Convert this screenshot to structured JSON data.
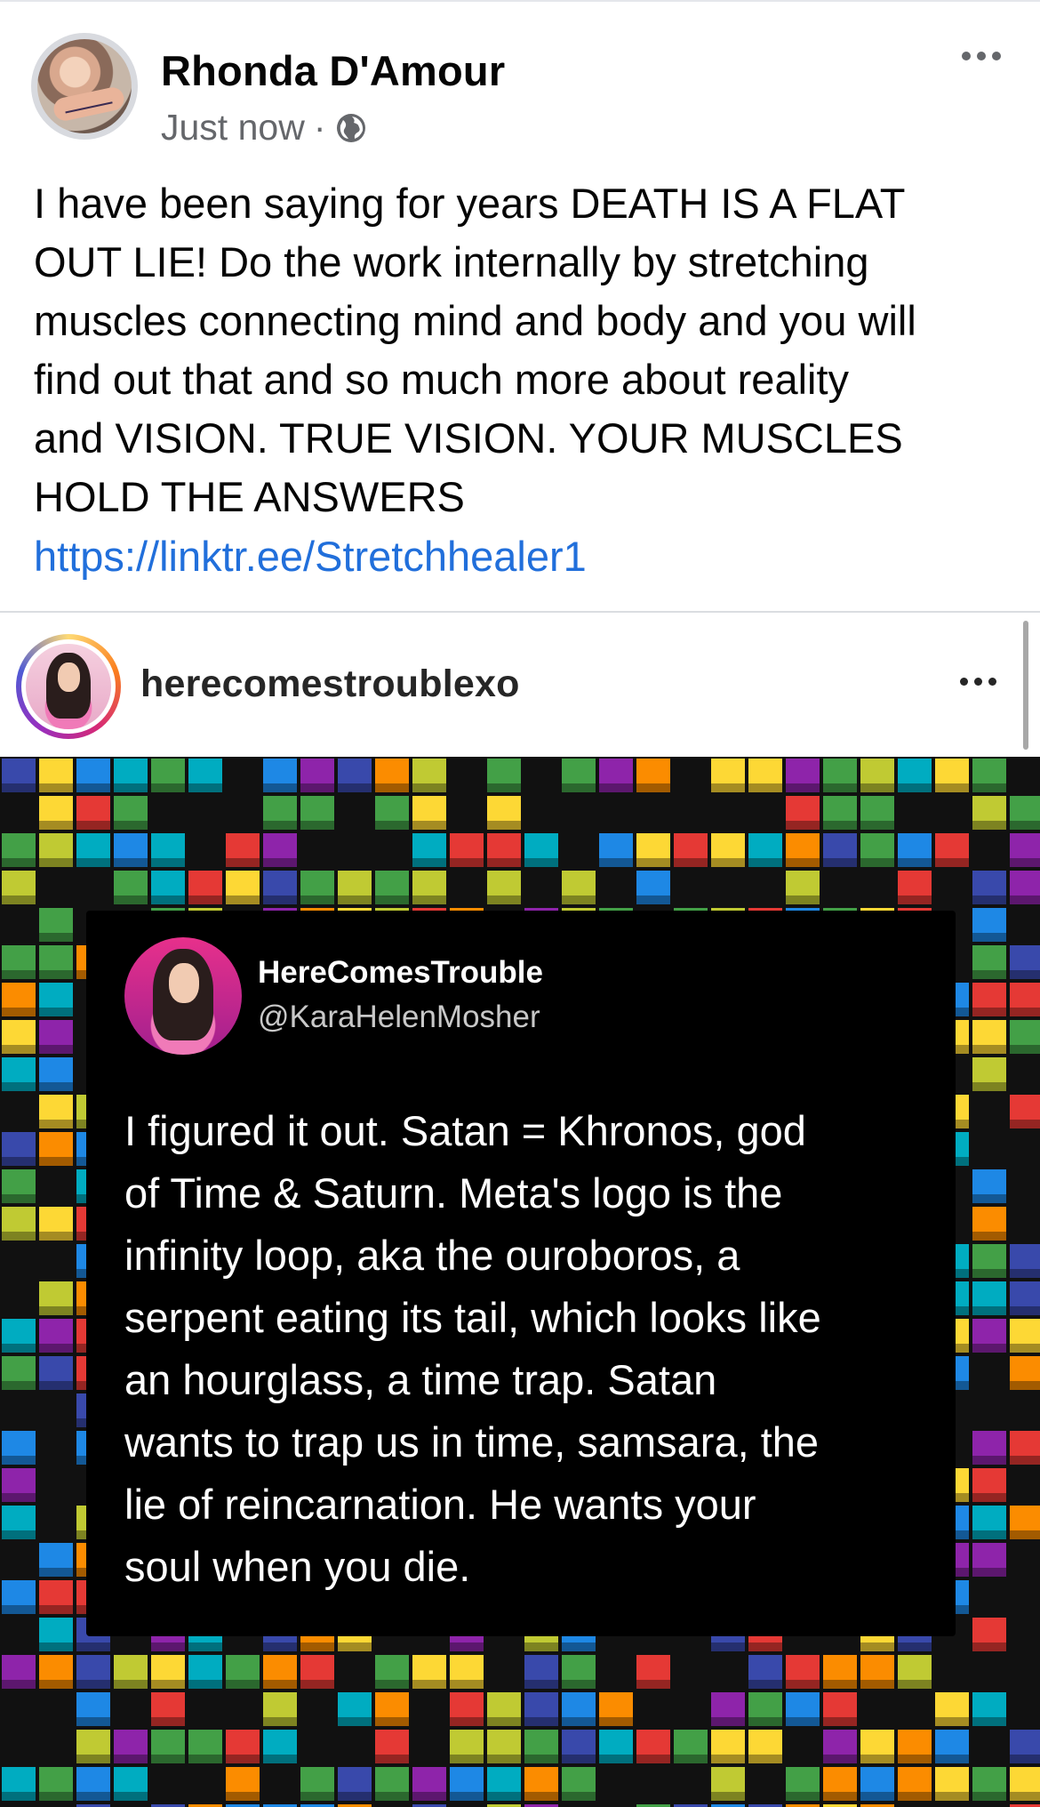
{
  "post": {
    "author": "Rhonda D'Amour",
    "timestamp": "Just now",
    "separator": "·",
    "visibility_icon": "globe-icon",
    "more_icon": "more-options-icon",
    "text": "I have been saying for years DEATH IS A FLAT\nOUT LIE! Do the work internally by stretching\nmuscles connecting mind and body and you will\nfind out that and so much more about reality\nand VISION. TRUE VISION. YOUR MUSCLES\nHOLD THE ANSWERS",
    "link": "https://linktr.ee/Stretchhealer1"
  },
  "embed": {
    "username": "herecomestroublexo",
    "more_icon": "more-options-icon",
    "tweet": {
      "display_name": "HereComesTrouble",
      "handle": "@KaraHelenMosher",
      "text": "I figured it out. Satan = Khronos, god\nof Time & Saturn. Meta's logo is the\ninfinity loop, aka the ouroboros, a\nserpent eating its tail, which looks like\nan hourglass, a time trap. Satan\nwants to trap us in time, samsara, the\nlie of reincarnation. He wants your\nsoul when you die."
    }
  },
  "colors": {
    "link": "#216fdb",
    "meta_text": "#65676b",
    "tweet_bg": "#000000"
  }
}
